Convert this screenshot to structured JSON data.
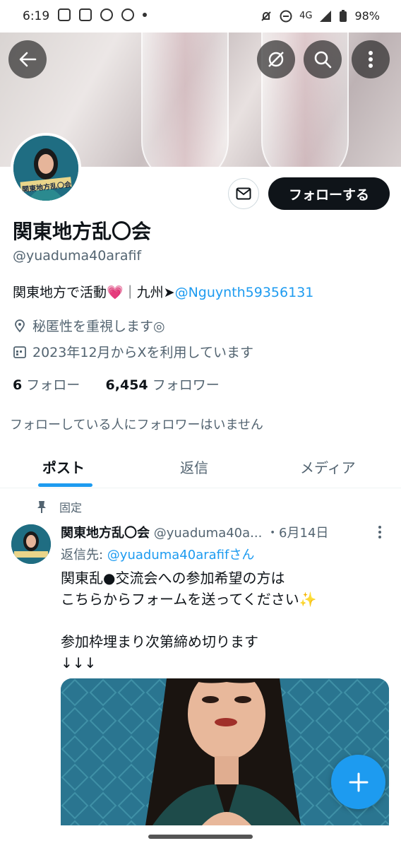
{
  "status_bar": {
    "time": "6:19",
    "network": "4G",
    "battery": "98%"
  },
  "profile": {
    "name": "関東地方乱〇会",
    "handle": "@yuaduma40arafif",
    "bio_text": "関東地方で活動💗｜九州➤",
    "bio_mention": "@Nguynth59356131",
    "location": "秘匿性を重視します◎",
    "joined": "2023年12月からXを利用しています",
    "following_count": "6",
    "following_label": "フォロー",
    "followers_count": "6,454",
    "followers_label": "フォロワー",
    "no_followers_known": "フォローしている人にフォロワーはいません",
    "avatar_banner_text": "関東地方乱〇会"
  },
  "actions": {
    "follow_label": "フォローする"
  },
  "tabs": [
    {
      "label": "ポスト",
      "active": true
    },
    {
      "label": "返信",
      "active": false
    },
    {
      "label": "メディア",
      "active": false
    }
  ],
  "pinned_post": {
    "pinned_label": "固定",
    "author_name": "関東地方乱〇会",
    "author_handle": "@yuaduma40a...",
    "date": "・6月14日",
    "reply_prefix": "返信先: ",
    "reply_to": "@yuaduma40arafifさん",
    "line1": "関東乱●交流会への参加希望の方は",
    "line2": "こちらからフォームを送ってください✨",
    "line3": "参加枠埋まり次第締め切ります",
    "line4": "↓↓↓",
    "avatar_caption": "関東地方乱〇会"
  },
  "fab": {
    "label": "+"
  },
  "colors": {
    "accent": "#1d9bf0",
    "text": "#0f1419",
    "muted": "#536471",
    "follow_bg": "#0f1419"
  },
  "icons": [
    "back-arrow-icon",
    "hide-icon",
    "search-icon",
    "more-vertical-icon",
    "mail-icon",
    "location-icon",
    "calendar-icon",
    "pin-icon",
    "plus-icon"
  ]
}
